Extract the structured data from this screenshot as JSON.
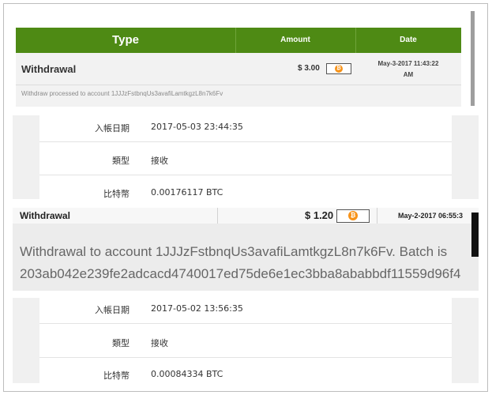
{
  "panel1": {
    "headers": {
      "type": "Type",
      "amount": "Amount",
      "date": "Date"
    },
    "row": {
      "type": "Withdrawal",
      "amount": "$ 3.00",
      "date_line1": "May-3-2017 11:43:22",
      "date_line2": "AM"
    },
    "note": "Withdraw processed to account 1JJJzFstbnqUs3avafiLamtkgzL8n7k6Fv"
  },
  "detail1": {
    "rows": [
      {
        "label": "入帳日期",
        "value": "2017-05-03 23:44:35"
      },
      {
        "label": "類型",
        "value": "接收"
      },
      {
        "label": "比特幣",
        "value": "0.00176117 BTC"
      }
    ]
  },
  "panel3": {
    "type": "Withdrawal",
    "amount": "$ 1.20",
    "date": "May-2-2017 06:55:3",
    "message_line1": "Withdrawal to account 1JJJzFstbnqUs3avafiLamtkgzL8n7k6Fv. Batch is",
    "message_line2": "203ab042e239fe2adcacd4740017ed75de6e1ec3bba8ababbdf11559d96f4"
  },
  "detail2": {
    "rows": [
      {
        "label": "入帳日期",
        "value": "2017-05-02 13:56:35"
      },
      {
        "label": "類型",
        "value": "接收"
      },
      {
        "label": "比特幣",
        "value": "0.00084334 BTC"
      }
    ]
  },
  "icons": {
    "coin": "bitcoin-coin-icon"
  },
  "colors": {
    "header_green": "#4e8a14",
    "coin_orange": "#f7931a"
  }
}
